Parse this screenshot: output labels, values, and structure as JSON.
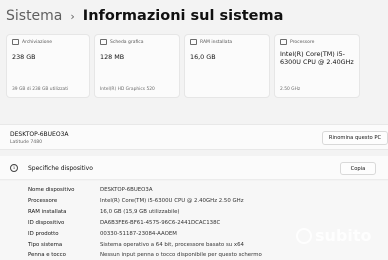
{
  "header": {
    "crumb": "Sistema",
    "separator": "›",
    "title": "Informazioni sul sistema"
  },
  "cards": [
    {
      "label": "Archiviazione",
      "value": "238 GB",
      "sub": "39 GB di 238 GB utilizzati",
      "icon": "storage-icon"
    },
    {
      "label": "Scheda grafica",
      "value": "128 MB",
      "sub": "Intel(R) HD Graphics 520",
      "icon": "graphics-card-icon"
    },
    {
      "label": "RAM installata",
      "value": "16,0 GB",
      "sub": "",
      "icon": "ram-icon"
    },
    {
      "label": "Processore",
      "value": "Intel(R) Core(TM) i5-6300U CPU @ 2.40GHz",
      "sub": "2.50 GHz",
      "icon": "processor-icon"
    }
  ],
  "device": {
    "name": "DESKTOP-6BUEO3A",
    "model": "Latitude 7480",
    "rename_label": "Rinomina questo PC"
  },
  "specs": {
    "title": "Specifiche dispositivo",
    "copy_label": "Copia",
    "rows": [
      {
        "key": "Nome dispositivo",
        "value": "DESKTOP-6BUEO3A"
      },
      {
        "key": "Processore",
        "value": "Intel(R) Core(TM) i5-6300U CPU @ 2.40GHz   2.50 GHz"
      },
      {
        "key": "RAM installata",
        "value": "16,0 GB (15,9 GB utilizzabile)"
      },
      {
        "key": "ID dispositivo",
        "value": "DA6B3FE6-BF61-4575-96C6-2441DCAC138C"
      },
      {
        "key": "ID prodotto",
        "value": "00330-51187-23084-AAOEM"
      },
      {
        "key": "Tipo sistema",
        "value": "Sistema operativo a 64 bit, processore basato su x64"
      },
      {
        "key": "Penna e tocco",
        "value": "Nessun input penna o tocco disponibile per questo schermo"
      }
    ]
  },
  "watermark": {
    "text": "subito"
  }
}
